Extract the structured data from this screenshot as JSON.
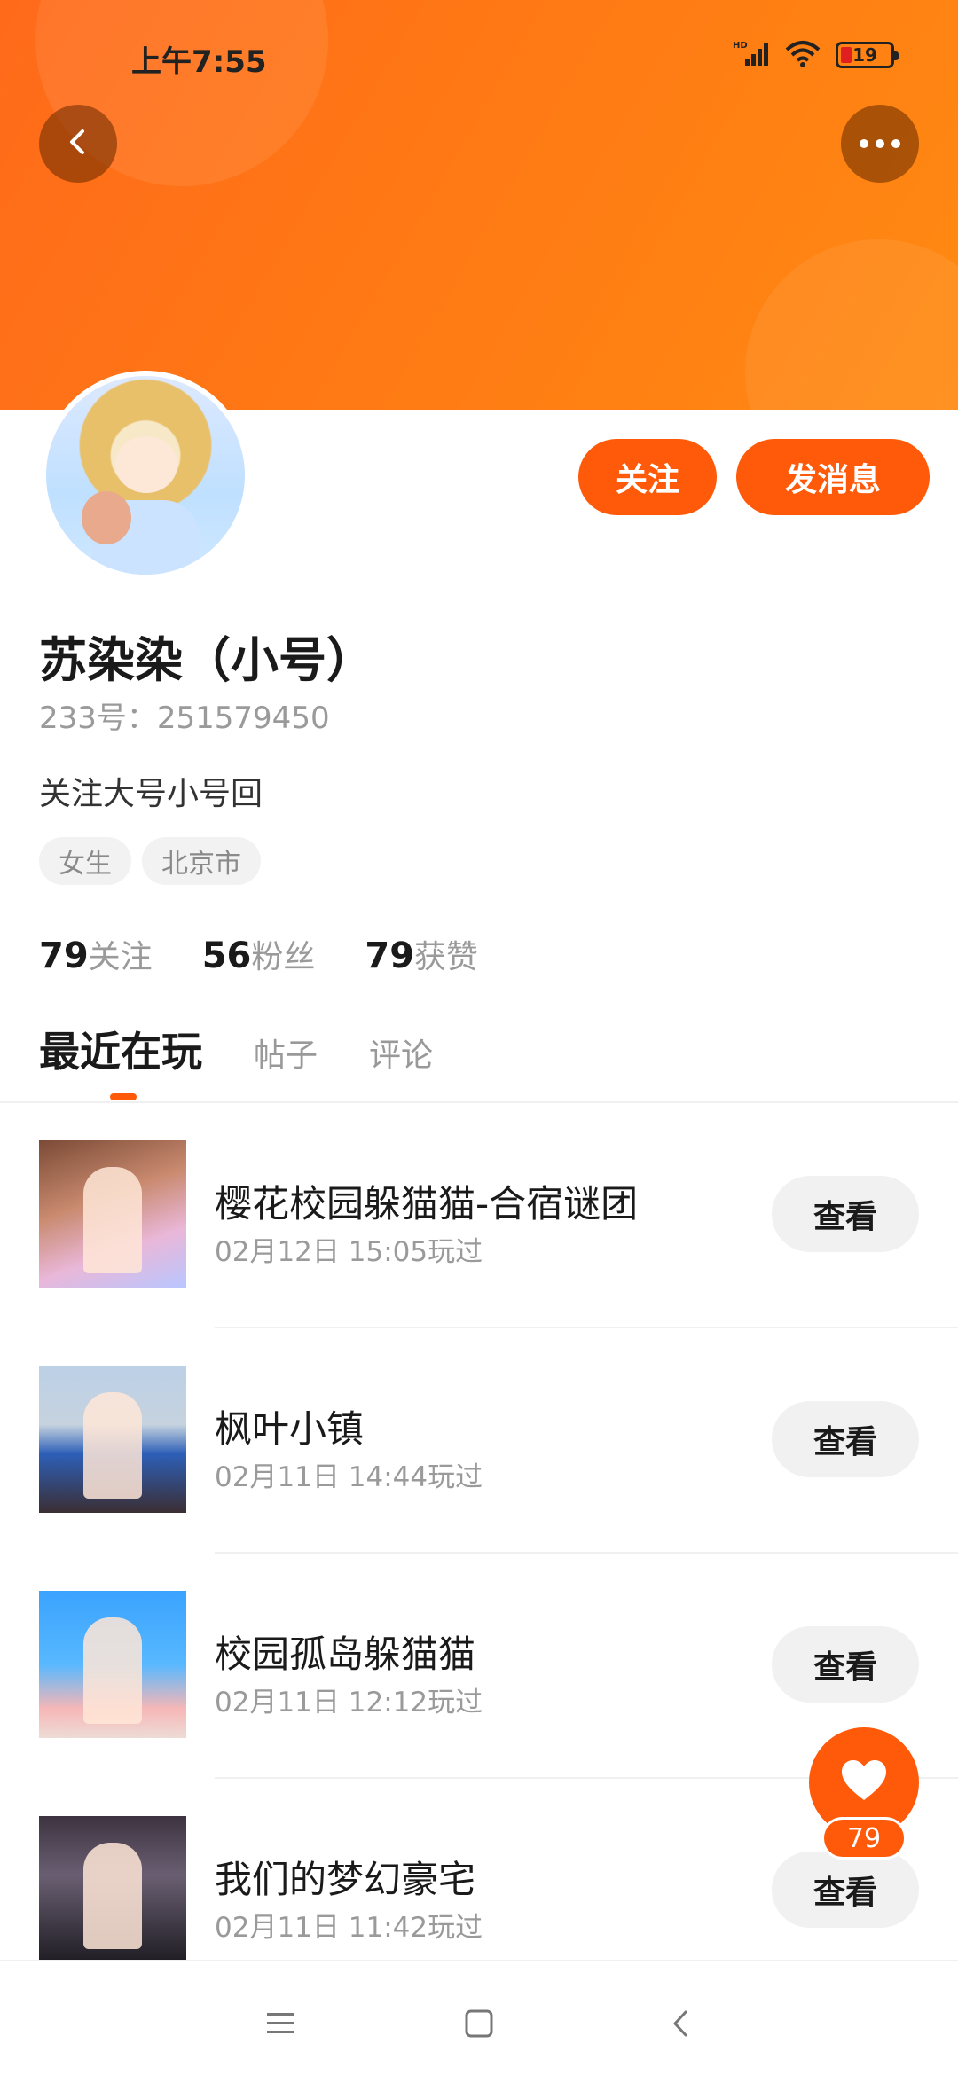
{
  "status_bar": {
    "time": "上午7:55",
    "battery": "19",
    "network": "HD"
  },
  "header": {
    "back_icon": "chevron-left-icon",
    "more_icon": "more-dots-icon"
  },
  "profile": {
    "name": "苏染染（小号）",
    "uid": "233号：251579450",
    "bio": "关注大号小号回",
    "tags": [
      "女生",
      "北京市"
    ],
    "follow_label": "关注",
    "message_label": "发消息",
    "stats": [
      {
        "num": "79",
        "label": "关注"
      },
      {
        "num": "56",
        "label": "粉丝"
      },
      {
        "num": "79",
        "label": "获赞"
      }
    ]
  },
  "tabs": [
    "最近在玩",
    "帖子",
    "评论"
  ],
  "games": [
    {
      "title": "樱花校园躲猫猫-合宿谜团",
      "time": "02月12日 15:05玩过",
      "action": "查看"
    },
    {
      "title": "枫叶小镇",
      "time": "02月11日 14:44玩过",
      "action": "查看"
    },
    {
      "title": "校园孤岛躲猫猫",
      "time": "02月11日 12:12玩过",
      "action": "查看"
    },
    {
      "title": "我们的梦幻豪宅",
      "time": "02月11日 11:42玩过",
      "action": "查看"
    }
  ],
  "like_fab": {
    "count": "79"
  },
  "colors": {
    "accent": "#ff5a0a",
    "banner": "#ff7a14"
  }
}
